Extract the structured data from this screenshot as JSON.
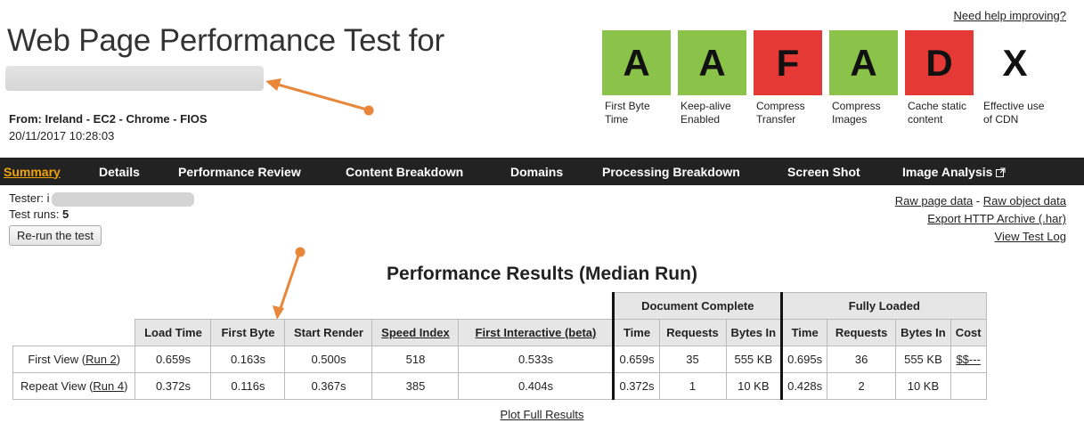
{
  "header": {
    "help_link": "Need help improving?",
    "title": "Web Page Performance Test for",
    "from_label": "From:",
    "from_value": "Ireland - EC2 - Chrome - FIOS",
    "date": "20/11/2017 10:28:03"
  },
  "grades": [
    {
      "letter": "A",
      "label": "First Byte Time",
      "color": "#8bc34a"
    },
    {
      "letter": "A",
      "label": "Keep-alive Enabled",
      "color": "#8bc34a"
    },
    {
      "letter": "F",
      "label": "Compress Transfer",
      "color": "#e53935"
    },
    {
      "letter": "A",
      "label": "Compress Images",
      "color": "#8bc34a"
    },
    {
      "letter": "D",
      "label": "Cache static content",
      "color": "#e53935"
    },
    {
      "letter": "X",
      "label": "Effective use of CDN",
      "color": "none"
    }
  ],
  "nav": {
    "items": [
      "Summary",
      "Details",
      "Performance Review",
      "Content Breakdown",
      "Domains",
      "Processing Breakdown",
      "Screen Shot",
      "Image Analysis"
    ],
    "active": "Summary",
    "external_icon": "external-link-icon"
  },
  "test_info": {
    "tester_label": "Tester: i",
    "runs_label": "Test runs:",
    "runs_value": "5",
    "rerun_button": "Re-run the test"
  },
  "links": {
    "raw_page": "Raw page data",
    "separator": "-",
    "raw_object": "Raw object data",
    "export_har": "Export HTTP Archive (.har)",
    "test_log": "View Test Log"
  },
  "results": {
    "title": "Performance Results (Median Run)",
    "group_doc": "Document Complete",
    "group_full": "Fully Loaded",
    "columns": [
      "Load Time",
      "First Byte",
      "Start Render",
      "Speed Index",
      "First Interactive (beta)",
      "Time",
      "Requests",
      "Bytes In",
      "Time",
      "Requests",
      "Bytes In",
      "Cost"
    ],
    "rows": [
      {
        "label": "First View (",
        "run": "Run 2",
        "close": ")",
        "values": [
          "0.659s",
          "0.163s",
          "0.500s",
          "518",
          "0.533s",
          "0.659s",
          "35",
          "555 KB",
          "0.695s",
          "36",
          "555 KB",
          "$$---"
        ]
      },
      {
        "label": "Repeat View (",
        "run": "Run 4",
        "close": ")",
        "values": [
          "0.372s",
          "0.116s",
          "0.367s",
          "385",
          "0.404s",
          "0.372s",
          "1",
          "10 KB",
          "0.428s",
          "2",
          "10 KB",
          ""
        ]
      }
    ],
    "plot_link": "Plot Full Results"
  },
  "annotation_color": "#e8873a"
}
